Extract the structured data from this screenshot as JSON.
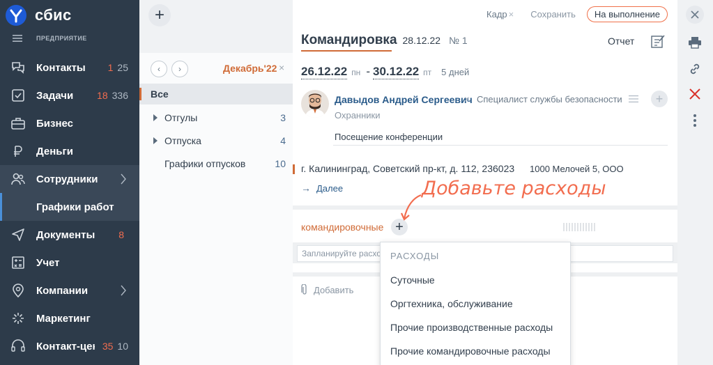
{
  "app": {
    "logo_text": "сбис",
    "org_label": "ПРЕДПРИЯТИЕ"
  },
  "sidebar": {
    "items": [
      {
        "label": "Контакты",
        "icon": "chat-bubbles-icon",
        "count_red": "1",
        "count_grey": "25"
      },
      {
        "label": "Задачи",
        "icon": "tasks-icon",
        "count_red": "18",
        "count_grey": "336"
      },
      {
        "label": "Бизнес",
        "icon": "briefcase-icon"
      },
      {
        "label": "Деньги",
        "icon": "money-icon"
      },
      {
        "label": "Сотрудники",
        "icon": "people-icon"
      },
      {
        "label": "Графики работ"
      },
      {
        "label": "Документы",
        "icon": "send-icon",
        "count_red": "8"
      },
      {
        "label": "Учет",
        "icon": "calculator-icon"
      },
      {
        "label": "Компании",
        "icon": "location-icon"
      },
      {
        "label": "Маркетинг",
        "icon": "cursor-icon"
      },
      {
        "label": "Контакт-центр",
        "icon": "headset-icon",
        "count_red": "35",
        "count_grey": "10"
      }
    ]
  },
  "middle": {
    "period": "Декабрь'22",
    "items": [
      {
        "label": "Все",
        "count": ""
      },
      {
        "label": "Отгулы",
        "count": "3"
      },
      {
        "label": "Отпуска",
        "count": "4"
      },
      {
        "label": "Графики отпусков",
        "count": "10"
      }
    ]
  },
  "doc": {
    "toolbar": {
      "kadr": "Кадр",
      "save": "Сохранить",
      "status": "На выполнение"
    },
    "title": "Командировка",
    "date": "28.12.22",
    "number": "№ 1",
    "report": "Отчет",
    "date_from": "26.12.22",
    "day_from": "пн",
    "date_to": "30.12.22",
    "day_to": "пт",
    "days": "5 дней",
    "employee": "Давыдов Андрей Сергеевич",
    "position": "Специалист службы безопасности",
    "department": "Охранники",
    "purpose": "Посещение конференции",
    "address": "г. Калининград, Советский пр-кт, д. 112, 236023",
    "organization": "1000 Мелочей 5, ООО",
    "more": "Далее",
    "expense_section": "командировочные",
    "plan_placeholder": "Запланируйте расходы",
    "attach": "Добавить"
  },
  "hint": "Добавьте расходы",
  "dropdown": {
    "header": "РАСХОДЫ",
    "items": [
      "Суточные",
      "Оргтехника, обслуживание",
      "Прочие производственные расходы",
      "Прочие командировочные расходы"
    ]
  },
  "colors": {
    "sidebar": "#2d3b4a",
    "accent": "#d06b37",
    "hint": "#f26d4f",
    "link": "#2a5b8a"
  }
}
